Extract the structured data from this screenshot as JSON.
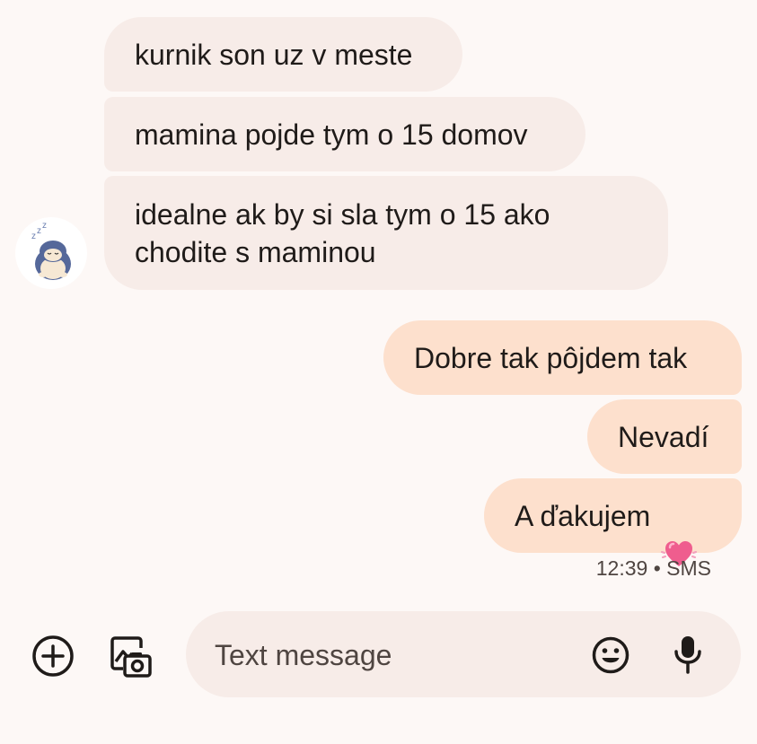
{
  "conversation": {
    "incoming": [
      {
        "text": "kurnik son uz v meste"
      },
      {
        "text": "mamina pojde tym o 15 domov"
      },
      {
        "text": "idealne ak by si sla tym o 15 ako\nchodite s maminou"
      }
    ],
    "outgoing": [
      {
        "text": "Dobre tak pôjdem tak"
      },
      {
        "text": "Nevadí"
      },
      {
        "text": "A ďakujem",
        "emoji_icon": "pink-heart-icon"
      }
    ],
    "timestamp": "12:39 • SMS",
    "avatar_icon": "sleeping-character-avatar"
  },
  "composer": {
    "placeholder": "Text message",
    "attach_icon": "add-circle-icon",
    "gallery_icon": "gallery-camera-icon",
    "emoji_icon": "emoji-icon",
    "mic_icon": "microphone-icon"
  },
  "colors": {
    "background": "#fdf8f6",
    "incoming_bubble": "#f7ece8",
    "outgoing_bubble": "#fde0cd",
    "heart": "#ef5d8e"
  }
}
